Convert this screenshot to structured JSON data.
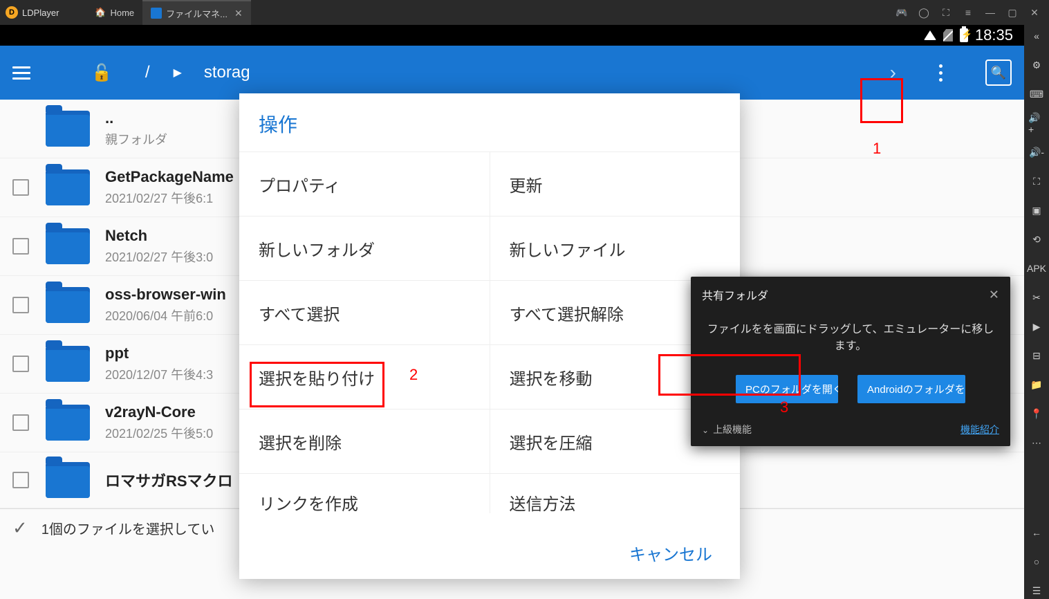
{
  "titlebar": {
    "app_name": "LDPlayer",
    "tabs": [
      {
        "label": "Home"
      },
      {
        "label": "ファイルマネ..."
      }
    ]
  },
  "android_status": {
    "time": "18:35"
  },
  "toolbar": {
    "path": "storag"
  },
  "annotations": {
    "num1": "1",
    "num2": "2",
    "num3": "3"
  },
  "files": [
    {
      "name": "..",
      "sub": "親フォルダ",
      "checkbox": false
    },
    {
      "name": "GetPackageName",
      "sub": "2021/02/27 午後6:1",
      "checkbox": true
    },
    {
      "name": "Netch",
      "sub": "2021/02/27 午後3:0",
      "checkbox": true
    },
    {
      "name": "oss-browser-win",
      "sub": "2020/06/04 午前6:0",
      "checkbox": true
    },
    {
      "name": "ppt",
      "sub": "2020/12/07 午後4:3",
      "checkbox": true
    },
    {
      "name": "v2rayN-Core",
      "sub": "2021/02/25 午後5:0",
      "checkbox": true
    },
    {
      "name": "ロマサガRSマクロ",
      "sub": "",
      "checkbox": true
    }
  ],
  "selection_bar": "1個のファイルを選択してい",
  "dialog": {
    "title": "操作",
    "rows": [
      [
        "プロパティ",
        "更新"
      ],
      [
        "新しいフォルダ",
        "新しいファイル"
      ],
      [
        "すべて選択",
        "すべて選択解除"
      ],
      [
        "選択を貼り付け",
        "選択を移動"
      ],
      [
        "選択を削除",
        "選択を圧縮"
      ],
      [
        "リンクを作成",
        "送信方法"
      ]
    ],
    "cancel": "キャンセル"
  },
  "share": {
    "title": "共有フォルダ",
    "desc": "ファイルをを画面にドラッグして、エミュレーターに移します。",
    "btn1": "PCのフォルダを開く",
    "btn2": "Androidのフォルダを開く",
    "advanced": "上級機能",
    "link": "機能紹介"
  }
}
